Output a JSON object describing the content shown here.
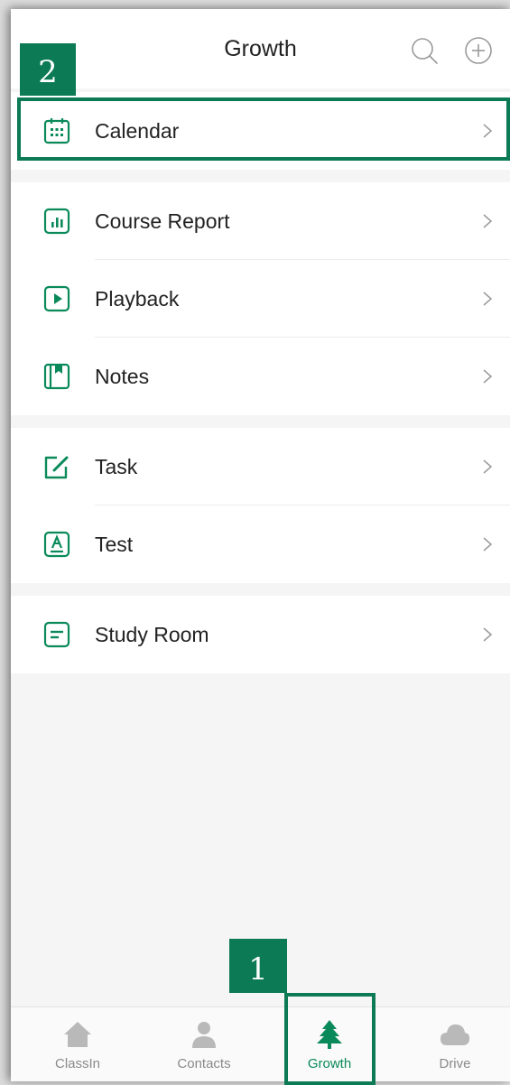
{
  "header": {
    "title": "Growth",
    "icons": [
      "search-icon",
      "add-circle-icon"
    ]
  },
  "sections": [
    {
      "items": [
        {
          "label": "Calendar",
          "icon": "calendar-icon"
        }
      ]
    },
    {
      "items": [
        {
          "label": "Course Report",
          "icon": "report-chart-icon"
        },
        {
          "label": "Playback",
          "icon": "play-icon"
        },
        {
          "label": "Notes",
          "icon": "notes-icon"
        }
      ]
    },
    {
      "items": [
        {
          "label": "Task",
          "icon": "edit-task-icon"
        },
        {
          "label": "Test",
          "icon": "test-icon"
        }
      ]
    },
    {
      "items": [
        {
          "label": "Study Room",
          "icon": "study-room-icon"
        }
      ]
    }
  ],
  "tabbar": {
    "tabs": [
      {
        "label": "ClassIn",
        "icon": "home-icon"
      },
      {
        "label": "Contacts",
        "icon": "person-icon"
      },
      {
        "label": "Growth",
        "icon": "tree-icon",
        "active": true
      },
      {
        "label": "Drive",
        "icon": "cloud-icon"
      }
    ]
  },
  "callouts": {
    "one": "1",
    "two": "2"
  },
  "colors": {
    "accent": "#0b7a55",
    "icon_green": "#0a8a5a",
    "background": "#f5f5f5"
  }
}
